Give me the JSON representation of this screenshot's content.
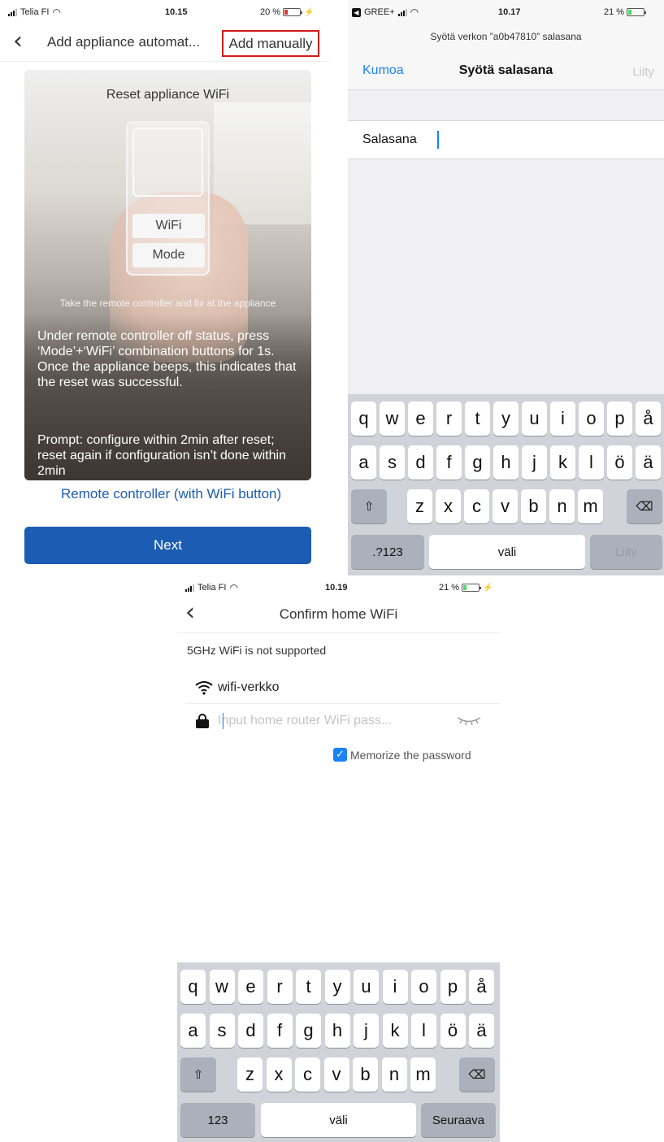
{
  "panel1": {
    "status": {
      "carrier": "Telia FI",
      "time": "10.15",
      "battery": "20 %",
      "battery_level": 0.2,
      "battery_color": "#e0342b"
    },
    "nav": {
      "title": "Add appliance automat...",
      "add_manually": "Add manually"
    },
    "card": {
      "title": "Reset appliance WiFi",
      "remote_wifi_button": "WiFi",
      "remote_mode_button": "Mode",
      "caption": "Take the remote controller and fix at the appliance",
      "description": "Under remote controller off status, press ‘Mode’+‘WiFi’ combination buttons for 1s. Once the appliance beeps, this indicates that the reset was successful.",
      "prompt": "Prompt: configure within 2min after reset; reset again if configuration isn’t done within 2min"
    },
    "remote_link": "Remote controller (with WiFi button)",
    "next": "Next",
    "accent_color": "#1c5db3",
    "highlight_color": "#d21b1b"
  },
  "panel2": {
    "status": {
      "app": "GREE+",
      "time": "10.17",
      "battery": "21 %",
      "battery_level": 0.21,
      "battery_color": "#4cd964"
    },
    "prompt": "Syötä verkon ”a0b47810” salasana",
    "cancel": "Kumoa",
    "title": "Syötä salasana",
    "join": "Liity",
    "password_label": "Salasana",
    "keyboard": {
      "row1": [
        "q",
        "w",
        "e",
        "r",
        "t",
        "y",
        "u",
        "i",
        "o",
        "p",
        "å"
      ],
      "row2": [
        "a",
        "s",
        "d",
        "f",
        "g",
        "h",
        "j",
        "k",
        "l",
        "ö",
        "ä"
      ],
      "row3": [
        "z",
        "x",
        "c",
        "v",
        "b",
        "n",
        "m"
      ],
      "numbers": ".?123",
      "space": "väli",
      "action": "Liity"
    }
  },
  "panel3": {
    "status": {
      "carrier": "Telia FI",
      "time": "10.19",
      "battery": "21 %",
      "battery_level": 0.21,
      "battery_color": "#4cd964"
    },
    "title": "Confirm home WiFi",
    "notice": "5GHz WiFi is not supported",
    "ssid": "wifi-verkko",
    "password_placeholder": "Input home router WiFi pass...",
    "memorize": "Memorize the password",
    "keyboard": {
      "row1": [
        "q",
        "w",
        "e",
        "r",
        "t",
        "y",
        "u",
        "i",
        "o",
        "p",
        "å"
      ],
      "row2": [
        "a",
        "s",
        "d",
        "f",
        "g",
        "h",
        "j",
        "k",
        "l",
        "ö",
        "ä"
      ],
      "row3": [
        "z",
        "x",
        "c",
        "v",
        "b",
        "n",
        "m"
      ],
      "numbers": "123",
      "space": "väli",
      "action": "Seuraava"
    }
  },
  "icons": {
    "back": "chevron-left-icon",
    "wifi": "wifi-icon",
    "lock": "lock-icon",
    "eye_closed": "eye-closed-icon",
    "shift": "shift-icon",
    "backspace": "backspace-icon",
    "checkbox": "checkmark-icon"
  }
}
